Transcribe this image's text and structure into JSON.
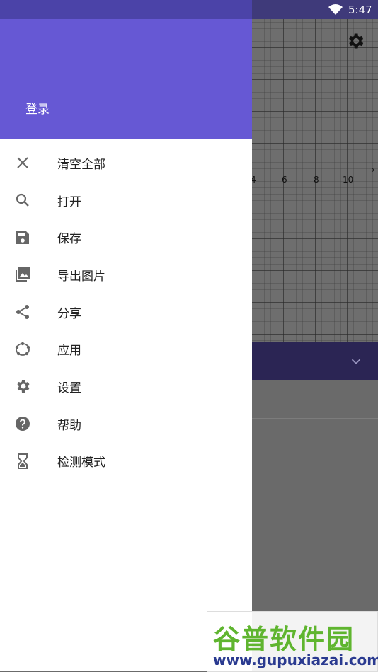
{
  "status_bar": {
    "time": "5:47"
  },
  "graph": {
    "ticks": [
      "4",
      "6",
      "8",
      "10"
    ]
  },
  "drawer": {
    "login_label": "登录",
    "items": [
      {
        "label": "清空全部",
        "icon": "close-icon"
      },
      {
        "label": "打开",
        "icon": "search-icon"
      },
      {
        "label": "保存",
        "icon": "save-icon"
      },
      {
        "label": "导出图片",
        "icon": "image-icon"
      },
      {
        "label": "分享",
        "icon": "share-icon"
      },
      {
        "label": "应用",
        "icon": "apps-icon"
      },
      {
        "label": "设置",
        "icon": "gear-icon"
      },
      {
        "label": "帮助",
        "icon": "help-icon"
      },
      {
        "label": "检测模式",
        "icon": "hourglass-icon"
      }
    ]
  },
  "watermark": {
    "title": "谷普软件园",
    "url": "www.gupuxiazai.com"
  },
  "colors": {
    "header": "#6658d4",
    "status_bar": "#4b43a8",
    "panel_bar": "#2b2554"
  }
}
